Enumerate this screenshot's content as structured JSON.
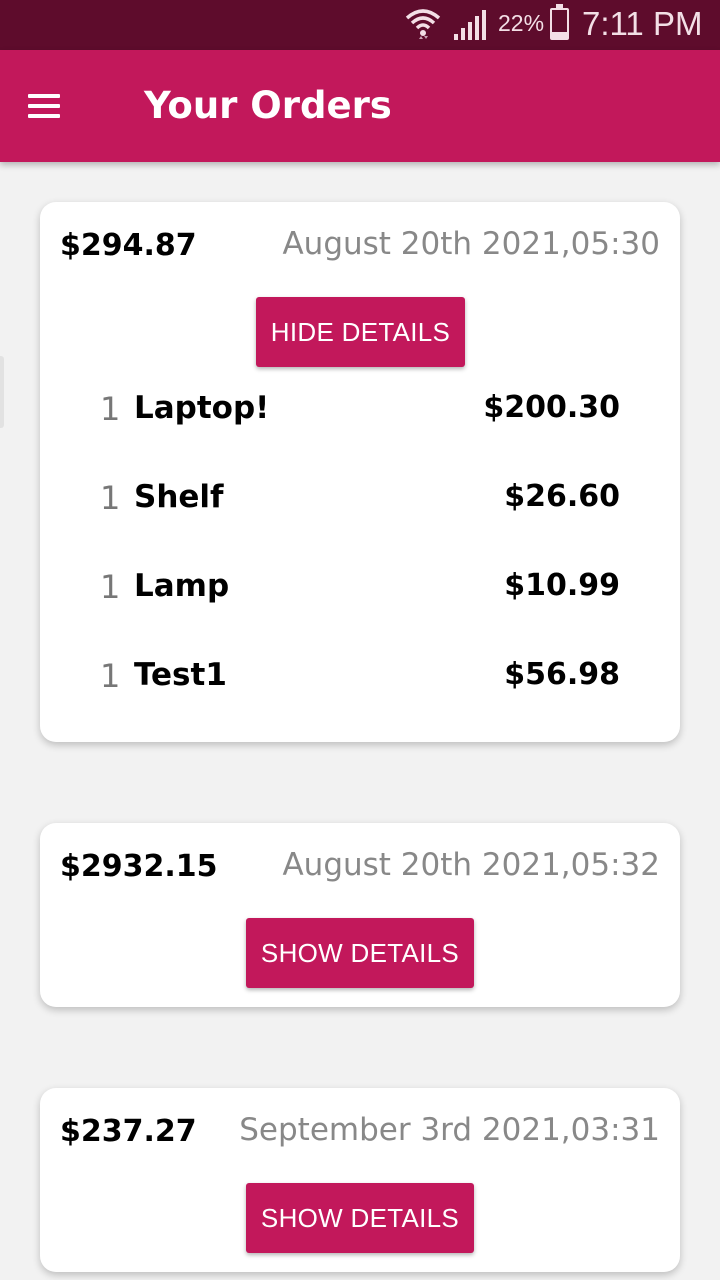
{
  "status_bar": {
    "battery_percent": "22%",
    "battery_level": 0.22,
    "time": "7:11 PM",
    "icons": [
      "wifi-icon",
      "signal-icon",
      "battery-icon"
    ]
  },
  "app_bar": {
    "title": "Your Orders",
    "menu_icon": "hamburger-menu-icon",
    "background": "#c2185b"
  },
  "orders": [
    {
      "total": "$294.87",
      "date": "August 20th 2021,05:30",
      "button_label": "HIDE DETAILS",
      "expanded": true,
      "items": [
        {
          "qty": "1",
          "name": "Laptop!",
          "price": "$200.30"
        },
        {
          "qty": "1",
          "name": "Shelf",
          "price": "$26.60"
        },
        {
          "qty": "1",
          "name": "Lamp",
          "price": "$10.99"
        },
        {
          "qty": "1",
          "name": "Test1",
          "price": "$56.98"
        }
      ]
    },
    {
      "total": "$2932.15",
      "date": "August 20th 2021,05:32",
      "button_label": "SHOW DETAILS",
      "expanded": false,
      "items": []
    },
    {
      "total": "$237.27",
      "date": "September 3rd 2021,03:31",
      "button_label": "SHOW DETAILS",
      "expanded": false,
      "items": []
    }
  ],
  "colors": {
    "accent": "#c2185b",
    "status_bar": "#5e0c2c",
    "background": "#f2f2f2",
    "date_text": "#888888"
  }
}
